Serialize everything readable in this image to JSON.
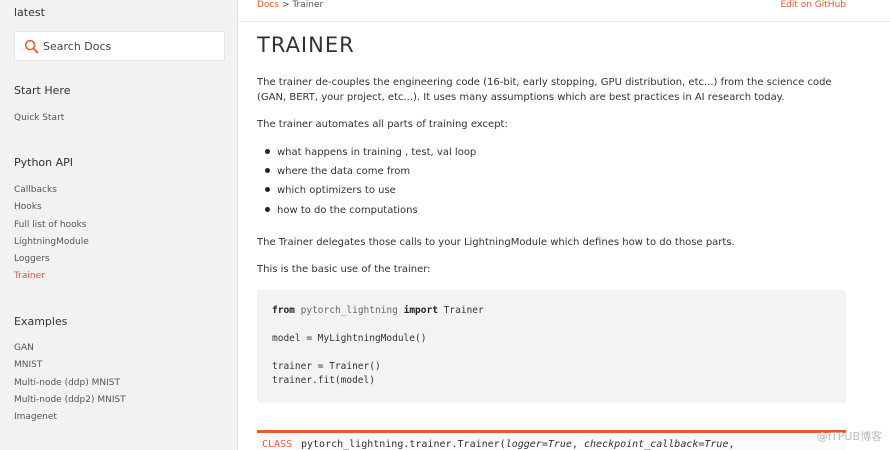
{
  "sidebar": {
    "version": "latest",
    "search_placeholder": "Search Docs",
    "sections": [
      {
        "title": "Start Here",
        "items": [
          "Quick Start"
        ]
      },
      {
        "title": "Python API",
        "items": [
          "Callbacks",
          "Hooks",
          "Full list of hooks",
          "LightningModule",
          "Loggers",
          "Trainer"
        ]
      },
      {
        "title": "Examples",
        "items": [
          "GAN",
          "MNIST",
          "Multi-node (ddp) MNIST",
          "Multi-node (ddp2) MNIST",
          "Imagenet"
        ]
      }
    ],
    "active_item": "Trainer"
  },
  "breadcrumb": {
    "link": "Docs",
    "separator": ">",
    "current": "Trainer"
  },
  "edit_link": "Edit on GitHub",
  "page": {
    "title": "TRAINER",
    "intro": "The trainer de-couples the engineering code (16-bit, early stopping, GPU distribution, etc...) from the science code (GAN, BERT, your project, etc...). It uses many assumptions which are best practices in AI research today.",
    "automates": "The trainer automates all parts of training except:",
    "bullets": [
      "what happens in training , test, val loop",
      "where the data come from",
      "which optimizers to use",
      "how to do the computations"
    ],
    "delegates": "The Trainer delegates those calls to your LightningModule which defines how to do those parts.",
    "basic_use": "This is the basic use of the trainer:"
  },
  "code": {
    "line1_kw1": "from",
    "line1_mod": "pytorch_lightning",
    "line1_kw2": "import",
    "line1_name": "Trainer",
    "line2": "model = MyLightningModule()",
    "line3": "trainer = Trainer()",
    "line4": "trainer.fit(model)"
  },
  "class_sig": {
    "label": "CLASS",
    "name": "pytorch_lightning.trainer.Trainer(",
    "arg1": "logger=True",
    "sep": ", ",
    "arg2": "checkpoint_callback=True",
    "tail": ","
  },
  "watermark": "@ITPUB博客",
  "colors": {
    "accent": "#e8582b",
    "sidebar_bg": "#f2f2f2",
    "code_bg": "#f3f3f3"
  }
}
